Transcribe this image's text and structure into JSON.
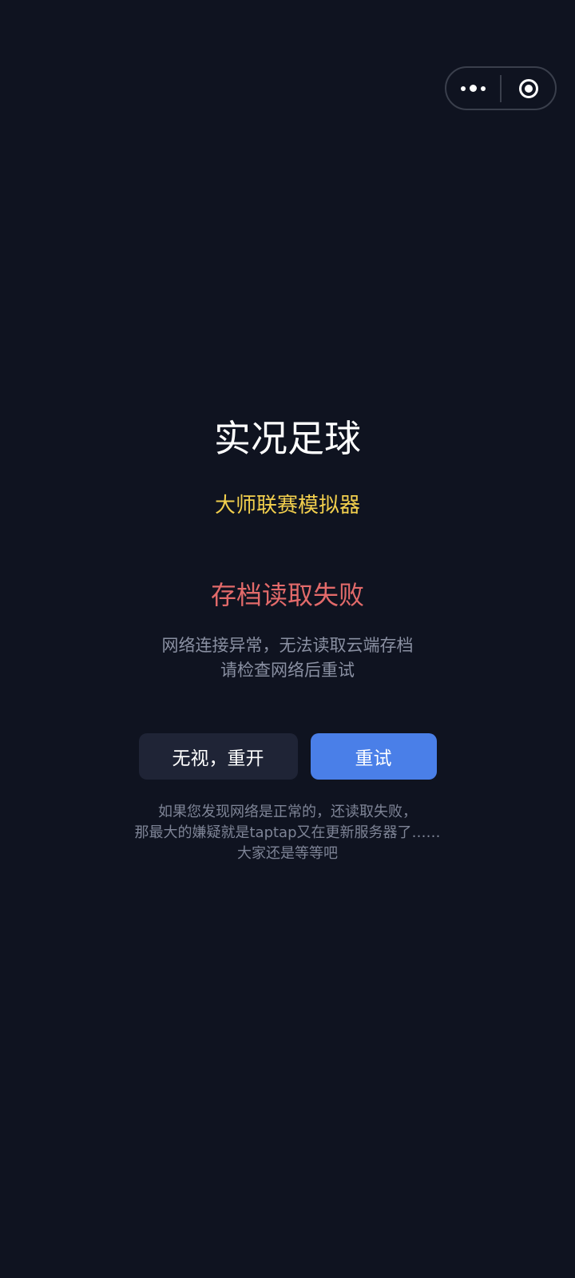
{
  "capsule": {
    "more_icon": "more-dots-icon",
    "close_icon": "target-circle-icon"
  },
  "game": {
    "title": "实况足球",
    "subtitle": "大师联赛模拟器"
  },
  "error": {
    "title": "存档读取失败",
    "lines": [
      "网络连接异常，无法读取云端存档",
      "请检查网络后重试"
    ]
  },
  "actions": {
    "ignore_label": "无视，重开",
    "retry_label": "重试"
  },
  "note": {
    "lines": [
      "如果您发现网络是正常的，还读取失败，",
      "那最大的嫌疑就是taptap又在更新服务器了……",
      "大家还是等等吧"
    ]
  },
  "colors": {
    "background": "#0f1320",
    "subtitle": "#f2cf4d",
    "error": "#e26a6a",
    "primary": "#4a7fe8",
    "secondary": "#1f2436"
  }
}
